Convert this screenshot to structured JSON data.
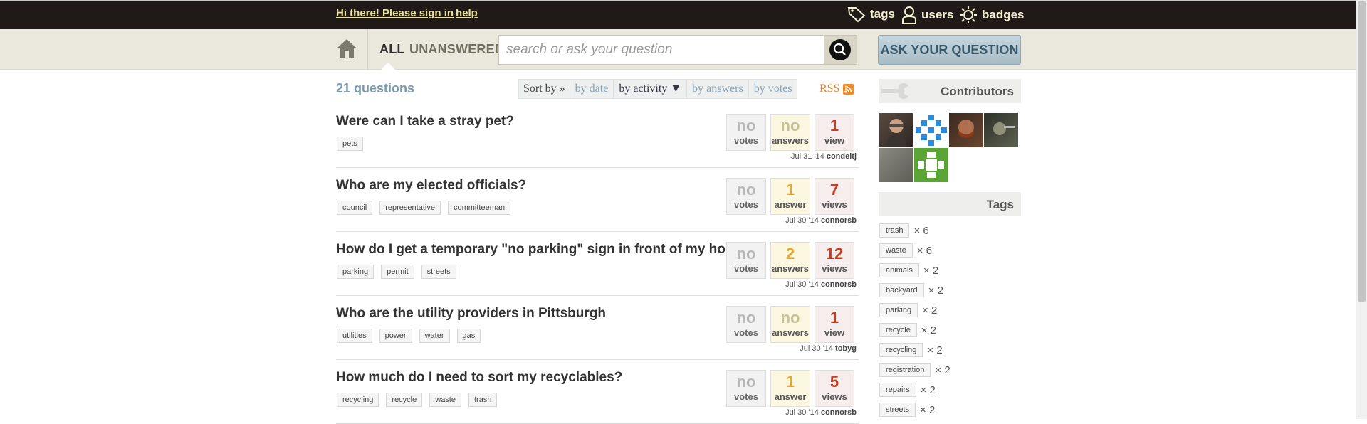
{
  "topbar": {
    "signin": "Hi there! Please sign in",
    "help": "help",
    "nav": [
      {
        "label": "tags",
        "icon": "tag-icon"
      },
      {
        "label": "users",
        "icon": "user-icon"
      },
      {
        "label": "badges",
        "icon": "badge-icon"
      }
    ]
  },
  "subbar": {
    "tabs": [
      "ALL",
      "UNANSWERED"
    ],
    "search_placeholder": "search or ask your question",
    "ask_button": "ASK YOUR QUESTION"
  },
  "main": {
    "count": "21 questions",
    "sort_label": "Sort by »",
    "sort_options": [
      "by date",
      "by activity ▼",
      "by answers",
      "by votes"
    ],
    "rss": "RSS",
    "questions": [
      {
        "title": "Were can I take a stray pet?",
        "tags": [
          "pets"
        ],
        "votes": "no",
        "votes_label": "votes",
        "answers": "no",
        "answers_label": "answers",
        "views": "1",
        "views_label": "view",
        "date": "Jul 31 '14",
        "user": "condeltj"
      },
      {
        "title": "Who are my elected officials?",
        "tags": [
          "council",
          "representative",
          "committeeman"
        ],
        "votes": "no",
        "votes_label": "votes",
        "answers": "1",
        "answers_label": "answer",
        "views": "7",
        "views_label": "views",
        "date": "Jul 30 '14",
        "user": "connorsb"
      },
      {
        "title": "How do I get a temporary \"no parking\" sign in front of my house?",
        "tags": [
          "parking",
          "permit",
          "streets"
        ],
        "votes": "no",
        "votes_label": "votes",
        "answers": "2",
        "answers_label": "answers",
        "views": "12",
        "views_label": "views",
        "date": "Jul 30 '14",
        "user": "connorsb"
      },
      {
        "title": "Who are the utility providers in Pittsburgh",
        "tags": [
          "utilities",
          "power",
          "water",
          "gas"
        ],
        "votes": "no",
        "votes_label": "votes",
        "answers": "no",
        "answers_label": "answers",
        "views": "1",
        "views_label": "view",
        "date": "Jul 30 '14",
        "user": "tobyg"
      },
      {
        "title": "How much do I need to sort my recyclables?",
        "tags": [
          "recycling",
          "recycle",
          "waste",
          "trash"
        ],
        "votes": "no",
        "votes_label": "votes",
        "answers": "1",
        "answers_label": "answer",
        "views": "5",
        "views_label": "views",
        "date": "Jul 30 '14",
        "user": "connorsb"
      }
    ]
  },
  "sidebar": {
    "contributors_title": "Contributors",
    "tags_title": "Tags",
    "tags": [
      {
        "name": "trash",
        "count": "× 6"
      },
      {
        "name": "waste",
        "count": "× 6"
      },
      {
        "name": "animals",
        "count": "× 2"
      },
      {
        "name": "backyard",
        "count": "× 2"
      },
      {
        "name": "parking",
        "count": "× 2"
      },
      {
        "name": "recycle",
        "count": "× 2"
      },
      {
        "name": "recycling",
        "count": "× 2"
      },
      {
        "name": "registration",
        "count": "× 2"
      },
      {
        "name": "repairs",
        "count": "× 2"
      },
      {
        "name": "streets",
        "count": "× 2"
      }
    ]
  },
  "colors": {
    "topbar_bg": "#1f1a17",
    "signin_link": "#ece39a",
    "accent_blue": "#7b99ad",
    "views_red": "#cc3b22",
    "answers_orange": "#e8a72b"
  }
}
